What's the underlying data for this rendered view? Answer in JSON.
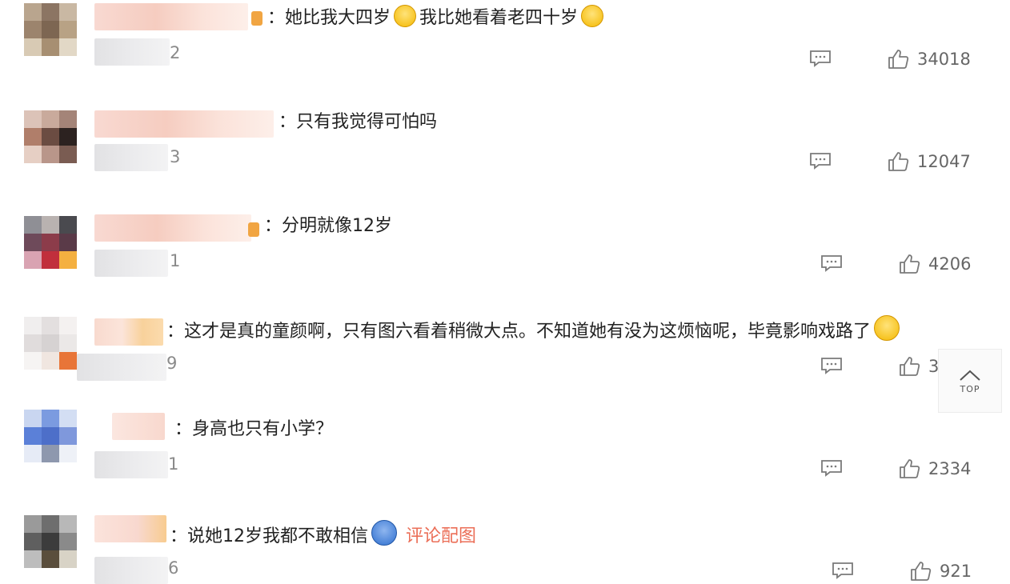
{
  "comments": [
    {
      "text_a": "：她比我大四岁",
      "text_b": "我比她看着老四十岁",
      "meta_tail": "2",
      "likes": "34018",
      "emoji_a": "cry-emoji",
      "emoji_b": "cry-emoji"
    },
    {
      "text_a": "：只有我觉得可怕吗",
      "meta_tail": "3",
      "likes": "12047"
    },
    {
      "text_a": "：分明就像12岁",
      "meta_tail": "1",
      "likes": "4206"
    },
    {
      "text_a": "：这才是真的童颜啊，只有图六看着稍微大点。不知道她有没为这烦恼呢，毕竟影响戏路了",
      "meta_tail": "9",
      "likes": "3",
      "emoji_a": "laugh-cry-emoji"
    },
    {
      "text_a": "：身高也只有小学？",
      "meta_tail": "1",
      "likes": "2334"
    },
    {
      "text_a": "：说她12岁我都不敢相信",
      "link": "评论配图",
      "meta_tail": "6",
      "likes": "921",
      "emoji_a": "doraemon-emoji"
    }
  ],
  "top_button": {
    "label": "TOP"
  },
  "colors": {
    "link": "#eb6e57",
    "text": "#222222",
    "count": "#666666"
  }
}
